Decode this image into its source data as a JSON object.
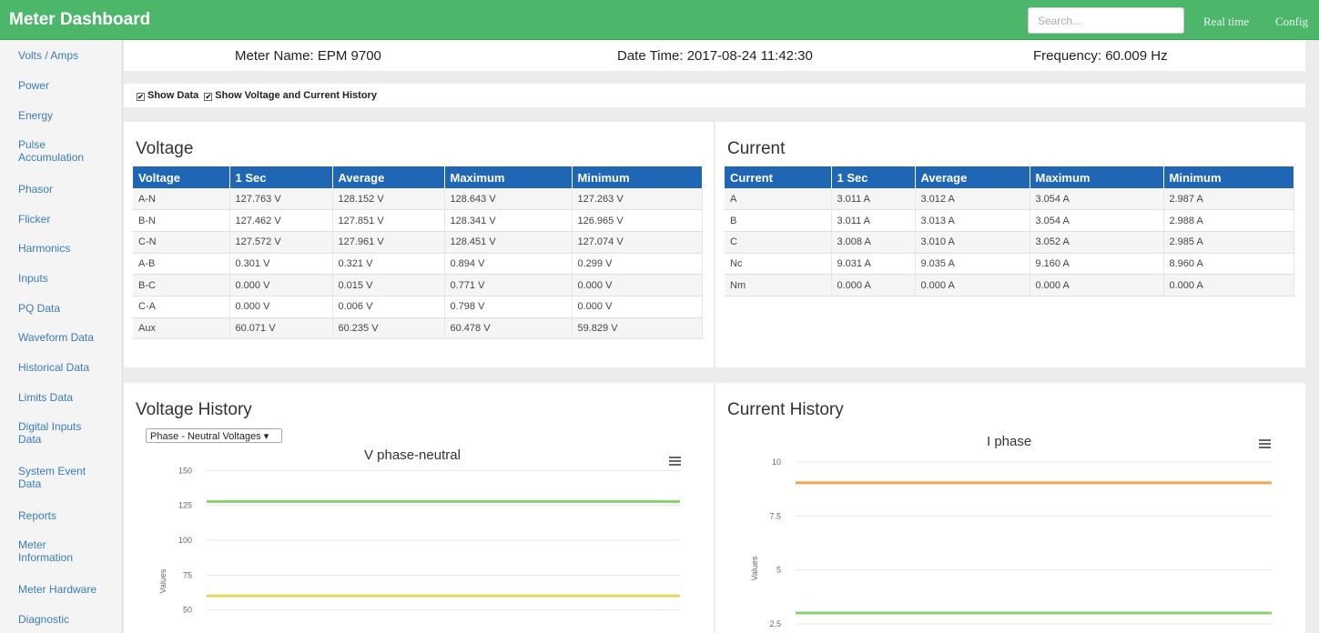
{
  "app": {
    "title": "Meter Dashboard",
    "search_placeholder": "Search...",
    "nav": [
      "Real time",
      "Config"
    ]
  },
  "sidebar": {
    "items": [
      "Volts / Amps",
      "Power",
      "Energy",
      "Pulse Accumulation",
      "Phasor",
      "Flicker",
      "Harmonics",
      "Inputs",
      "PQ Data",
      "Waveform Data",
      "Historical Data",
      "Limits Data",
      "Digital Inputs Data",
      "System Event Data",
      "Reports",
      "Meter Information",
      "Meter Hardware",
      "Diagnostic"
    ]
  },
  "info": {
    "meter_name": "Meter Name: EPM 9700",
    "date_time": "Date Time: 2017-08-24 11:42:30",
    "frequency": "Frequency: 60.009 Hz"
  },
  "options": {
    "show_data": "Show Data",
    "show_history": "Show Voltage and Current History",
    "checked_mark": "✔"
  },
  "voltage": {
    "title": "Voltage",
    "headers": [
      "Voltage",
      "1 Sec",
      "Average",
      "Maximum",
      "Minimum"
    ],
    "rows": [
      [
        "A-N",
        "127.763 V",
        "128.152 V",
        "128.643 V",
        "127.263 V"
      ],
      [
        "B-N",
        "127.462 V",
        "127.851 V",
        "128.341 V",
        "126.965 V"
      ],
      [
        "C-N",
        "127.572 V",
        "127.961 V",
        "128.451 V",
        "127.074 V"
      ],
      [
        "A-B",
        "0.301 V",
        "0.321 V",
        "0.894 V",
        "0.299 V"
      ],
      [
        "B-C",
        "0.000 V",
        "0.015 V",
        "0.771 V",
        "0.000 V"
      ],
      [
        "C-A",
        "0.000 V",
        "0.006 V",
        "0.798 V",
        "0.000 V"
      ],
      [
        "Aux",
        "60.071 V",
        "60.235 V",
        "60.478 V",
        "59.829 V"
      ]
    ]
  },
  "current": {
    "title": "Current",
    "headers": [
      "Current",
      "1 Sec",
      "Average",
      "Maximum",
      "Minimum"
    ],
    "rows": [
      [
        "A",
        "3.011 A",
        "3.012 A",
        "3.054 A",
        "2.987 A"
      ],
      [
        "B",
        "3.011 A",
        "3.013 A",
        "3.054 A",
        "2.988 A"
      ],
      [
        "C",
        "3.008 A",
        "3.010 A",
        "3.052 A",
        "2.985 A"
      ],
      [
        "Nc",
        "9.031 A",
        "9.035 A",
        "9.160 A",
        "8.960 A"
      ],
      [
        "Nm",
        "0.000 A",
        "0.000 A",
        "0.000 A",
        "0.000 A"
      ]
    ]
  },
  "voltage_history": {
    "title": "Voltage History",
    "selected_option": "Phase - Neutral Voltages",
    "dropdown_arrow": "▾"
  },
  "current_history": {
    "title": "Current History"
  },
  "chart_data": [
    {
      "type": "line",
      "title": "V phase-neutral",
      "ylabel": "Values",
      "yticks": [
        150,
        125,
        100,
        75,
        50
      ],
      "ylim": [
        40,
        160
      ],
      "series": [
        {
          "color": "#8ccf6d",
          "values": [
            127.8,
            127.8
          ]
        },
        {
          "color": "#e3d75b",
          "values": [
            60.1,
            60.1
          ]
        }
      ]
    },
    {
      "type": "line",
      "title": "I phase",
      "ylabel": "Values",
      "yticks": [
        10,
        7.5,
        5,
        2.5
      ],
      "ylim": [
        2,
        10.5
      ],
      "series": [
        {
          "color": "#f0a553",
          "values": [
            9.03,
            9.03
          ]
        },
        {
          "color": "#8ccf6d",
          "values": [
            3.01,
            3.01
          ]
        }
      ]
    }
  ]
}
